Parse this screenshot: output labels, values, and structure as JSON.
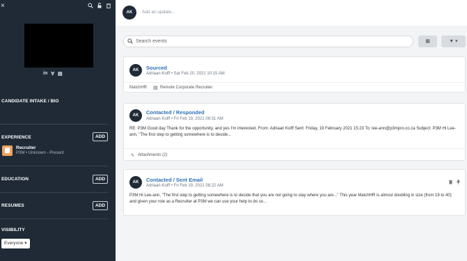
{
  "sidebar": {
    "close_icon": "×",
    "tools": [
      "search-icon",
      "lock-icon",
      "trash-icon"
    ],
    "social": [
      "in",
      "∀",
      "▤"
    ],
    "sections": {
      "intake": "CANDIDATE INTAKE / BIO",
      "experience": "EXPERIENCE",
      "education": "EDUCATION",
      "resumes": "RESUMES",
      "visibility": "VISIBILITY"
    },
    "add_label": "ADD",
    "experience_item": {
      "title": "Recruiter",
      "subtitle": "P3M  •  Unknown - Present"
    },
    "visibility_value": "Everyone ▾"
  },
  "update": {
    "avatar": "AK",
    "placeholder": "Add an update..."
  },
  "search": {
    "placeholder": "Search events",
    "calendar_icon": "▦",
    "filter_icon": "▼ ▾"
  },
  "events": [
    {
      "avatar": "AK",
      "title": "Sourced",
      "meta": "Adriaan Kolff • Sat Feb 20, 2021 10:15 AM",
      "footer_source": "MatchHR",
      "footer_job": "Remote Corporate Recruiter"
    },
    {
      "avatar": "AK",
      "title": "Contacted / Responded",
      "meta": "Adriaan Kolff • Fri Feb 19, 2021 08:31 AM",
      "body": "RE: P3M Good day Thank for the opportunity, and yes I'm interested. From: Adriaan Kolff Sent: Friday, 19 February 2021 15:23 To: lee-ann@p3mpro.co.za Subject: P3M Hi Lee-ann, \"The first step to getting somewhere is to decide...",
      "attachments": "Attachments (2)"
    },
    {
      "avatar": "AK",
      "title": "Contacted / Sent Email",
      "meta": "Adriaan Kolff • Fri Feb 19, 2021 08:22 AM",
      "body": "P3M Hi Lee-ann, \"The first step to getting somewhere is to decide that you are not going to stay where you are...\" This year MatchHR is almost doubling in size (from 19 to 40) and given your role as a Recruiter at P3M we can use your help to do so..."
    }
  ]
}
